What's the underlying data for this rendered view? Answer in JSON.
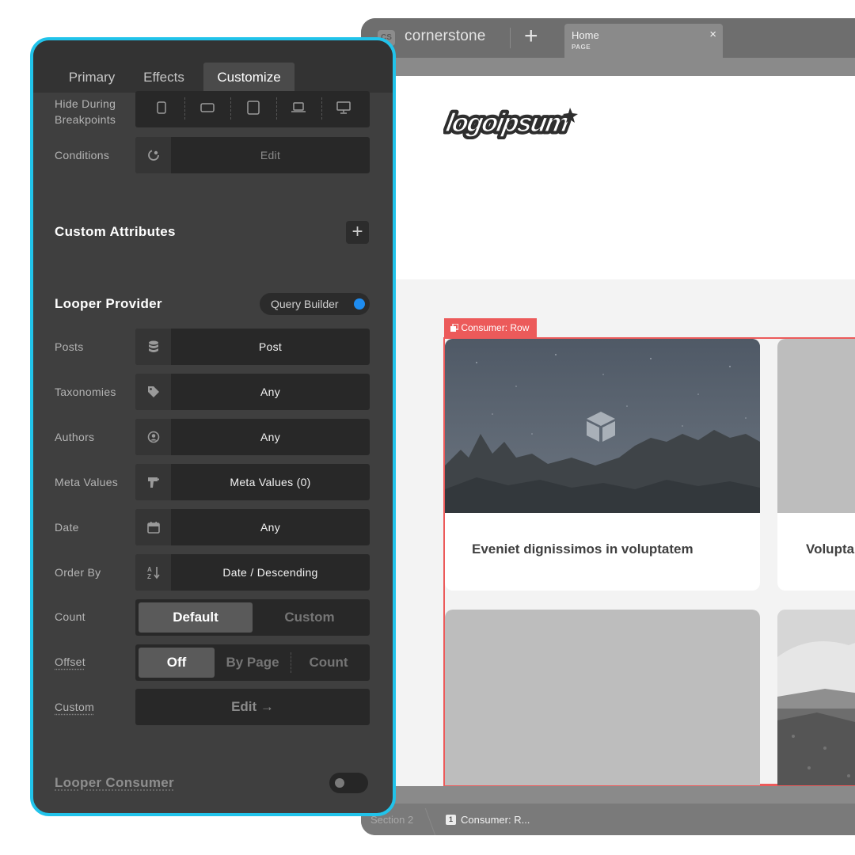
{
  "builder": {
    "app_name": "cornerstone",
    "logo_letters": "CS",
    "new_tab_symbol": "+",
    "tab": {
      "title": "Home",
      "subtitle": "PAGE",
      "close_symbol": "×"
    },
    "canvas": {
      "logo_text": "logoipsum",
      "row_tag": "Consumer: Row",
      "cards": [
        {
          "title": "Eveniet dignissimos in voluptatem"
        },
        {
          "title": "Volupta"
        },
        {
          "title": ""
        },
        {
          "title": ""
        }
      ]
    },
    "breadcrumb": {
      "section": "Section 2",
      "badge": "1",
      "current": "Consumer: R..."
    }
  },
  "panel": {
    "tabs": [
      "Primary",
      "Effects",
      "Customize"
    ],
    "active_tab": "Customize",
    "hide_during_breakpoints": {
      "label_line1": "Hide During",
      "label_line2": "Breakpoints",
      "icons": [
        "phone-icon",
        "phone-landscape-icon",
        "tablet-icon",
        "laptop-icon",
        "desktop-icon"
      ]
    },
    "conditions": {
      "label": "Conditions",
      "value": "Edit"
    },
    "custom_attributes": {
      "title": "Custom Attributes",
      "add_symbol": "+"
    },
    "looper_provider": {
      "title": "Looper Provider",
      "query_builder_label": "Query Builder",
      "query_builder_on": true,
      "accent": "#1e8cf0",
      "rows": [
        {
          "label": "Posts",
          "value": "Post",
          "icon": "database-icon"
        },
        {
          "label": "Taxonomies",
          "value": "Any",
          "icon": "tag-icon"
        },
        {
          "label": "Authors",
          "value": "Any",
          "icon": "user-circle-icon"
        },
        {
          "label": "Meta Values",
          "value": "Meta Values (0)",
          "icon": "drill-icon"
        },
        {
          "label": "Date",
          "value": "Any",
          "icon": "calendar-icon"
        },
        {
          "label": "Order By",
          "value": "Date / Descending",
          "icon": "sort-az-icon"
        }
      ],
      "count": {
        "label": "Count",
        "options": [
          "Default",
          "Custom"
        ],
        "selected": "Default"
      },
      "offset": {
        "label": "Offset",
        "options": [
          "Off",
          "By Page",
          "Count"
        ],
        "selected": "Off"
      },
      "custom": {
        "label": "Custom",
        "button": "Edit →"
      }
    },
    "looper_consumer": {
      "title": "Looper Consumer",
      "enabled": false
    },
    "frame_color": "#21c3ea",
    "row_outline_color": "#ec5a5a"
  }
}
